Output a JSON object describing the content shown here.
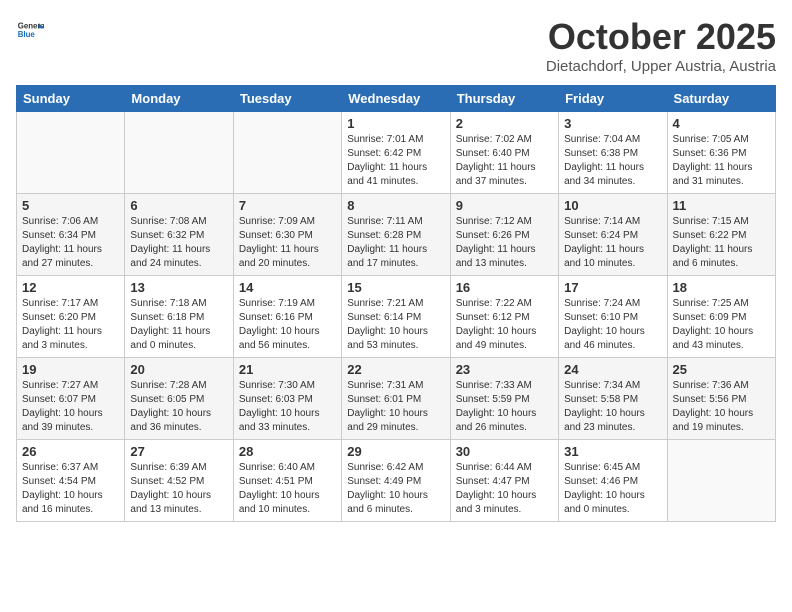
{
  "header": {
    "logo_general": "General",
    "logo_blue": "Blue",
    "title": "October 2025",
    "subtitle": "Dietachdorf, Upper Austria, Austria"
  },
  "weekdays": [
    "Sunday",
    "Monday",
    "Tuesday",
    "Wednesday",
    "Thursday",
    "Friday",
    "Saturday"
  ],
  "weeks": [
    [
      {
        "day": "",
        "info": ""
      },
      {
        "day": "",
        "info": ""
      },
      {
        "day": "",
        "info": ""
      },
      {
        "day": "1",
        "info": "Sunrise: 7:01 AM\nSunset: 6:42 PM\nDaylight: 11 hours\nand 41 minutes."
      },
      {
        "day": "2",
        "info": "Sunrise: 7:02 AM\nSunset: 6:40 PM\nDaylight: 11 hours\nand 37 minutes."
      },
      {
        "day": "3",
        "info": "Sunrise: 7:04 AM\nSunset: 6:38 PM\nDaylight: 11 hours\nand 34 minutes."
      },
      {
        "day": "4",
        "info": "Sunrise: 7:05 AM\nSunset: 6:36 PM\nDaylight: 11 hours\nand 31 minutes."
      }
    ],
    [
      {
        "day": "5",
        "info": "Sunrise: 7:06 AM\nSunset: 6:34 PM\nDaylight: 11 hours\nand 27 minutes."
      },
      {
        "day": "6",
        "info": "Sunrise: 7:08 AM\nSunset: 6:32 PM\nDaylight: 11 hours\nand 24 minutes."
      },
      {
        "day": "7",
        "info": "Sunrise: 7:09 AM\nSunset: 6:30 PM\nDaylight: 11 hours\nand 20 minutes."
      },
      {
        "day": "8",
        "info": "Sunrise: 7:11 AM\nSunset: 6:28 PM\nDaylight: 11 hours\nand 17 minutes."
      },
      {
        "day": "9",
        "info": "Sunrise: 7:12 AM\nSunset: 6:26 PM\nDaylight: 11 hours\nand 13 minutes."
      },
      {
        "day": "10",
        "info": "Sunrise: 7:14 AM\nSunset: 6:24 PM\nDaylight: 11 hours\nand 10 minutes."
      },
      {
        "day": "11",
        "info": "Sunrise: 7:15 AM\nSunset: 6:22 PM\nDaylight: 11 hours\nand 6 minutes."
      }
    ],
    [
      {
        "day": "12",
        "info": "Sunrise: 7:17 AM\nSunset: 6:20 PM\nDaylight: 11 hours\nand 3 minutes."
      },
      {
        "day": "13",
        "info": "Sunrise: 7:18 AM\nSunset: 6:18 PM\nDaylight: 11 hours\nand 0 minutes."
      },
      {
        "day": "14",
        "info": "Sunrise: 7:19 AM\nSunset: 6:16 PM\nDaylight: 10 hours\nand 56 minutes."
      },
      {
        "day": "15",
        "info": "Sunrise: 7:21 AM\nSunset: 6:14 PM\nDaylight: 10 hours\nand 53 minutes."
      },
      {
        "day": "16",
        "info": "Sunrise: 7:22 AM\nSunset: 6:12 PM\nDaylight: 10 hours\nand 49 minutes."
      },
      {
        "day": "17",
        "info": "Sunrise: 7:24 AM\nSunset: 6:10 PM\nDaylight: 10 hours\nand 46 minutes."
      },
      {
        "day": "18",
        "info": "Sunrise: 7:25 AM\nSunset: 6:09 PM\nDaylight: 10 hours\nand 43 minutes."
      }
    ],
    [
      {
        "day": "19",
        "info": "Sunrise: 7:27 AM\nSunset: 6:07 PM\nDaylight: 10 hours\nand 39 minutes."
      },
      {
        "day": "20",
        "info": "Sunrise: 7:28 AM\nSunset: 6:05 PM\nDaylight: 10 hours\nand 36 minutes."
      },
      {
        "day": "21",
        "info": "Sunrise: 7:30 AM\nSunset: 6:03 PM\nDaylight: 10 hours\nand 33 minutes."
      },
      {
        "day": "22",
        "info": "Sunrise: 7:31 AM\nSunset: 6:01 PM\nDaylight: 10 hours\nand 29 minutes."
      },
      {
        "day": "23",
        "info": "Sunrise: 7:33 AM\nSunset: 5:59 PM\nDaylight: 10 hours\nand 26 minutes."
      },
      {
        "day": "24",
        "info": "Sunrise: 7:34 AM\nSunset: 5:58 PM\nDaylight: 10 hours\nand 23 minutes."
      },
      {
        "day": "25",
        "info": "Sunrise: 7:36 AM\nSunset: 5:56 PM\nDaylight: 10 hours\nand 19 minutes."
      }
    ],
    [
      {
        "day": "26",
        "info": "Sunrise: 6:37 AM\nSunset: 4:54 PM\nDaylight: 10 hours\nand 16 minutes."
      },
      {
        "day": "27",
        "info": "Sunrise: 6:39 AM\nSunset: 4:52 PM\nDaylight: 10 hours\nand 13 minutes."
      },
      {
        "day": "28",
        "info": "Sunrise: 6:40 AM\nSunset: 4:51 PM\nDaylight: 10 hours\nand 10 minutes."
      },
      {
        "day": "29",
        "info": "Sunrise: 6:42 AM\nSunset: 4:49 PM\nDaylight: 10 hours\nand 6 minutes."
      },
      {
        "day": "30",
        "info": "Sunrise: 6:44 AM\nSunset: 4:47 PM\nDaylight: 10 hours\nand 3 minutes."
      },
      {
        "day": "31",
        "info": "Sunrise: 6:45 AM\nSunset: 4:46 PM\nDaylight: 10 hours\nand 0 minutes."
      },
      {
        "day": "",
        "info": ""
      }
    ]
  ]
}
